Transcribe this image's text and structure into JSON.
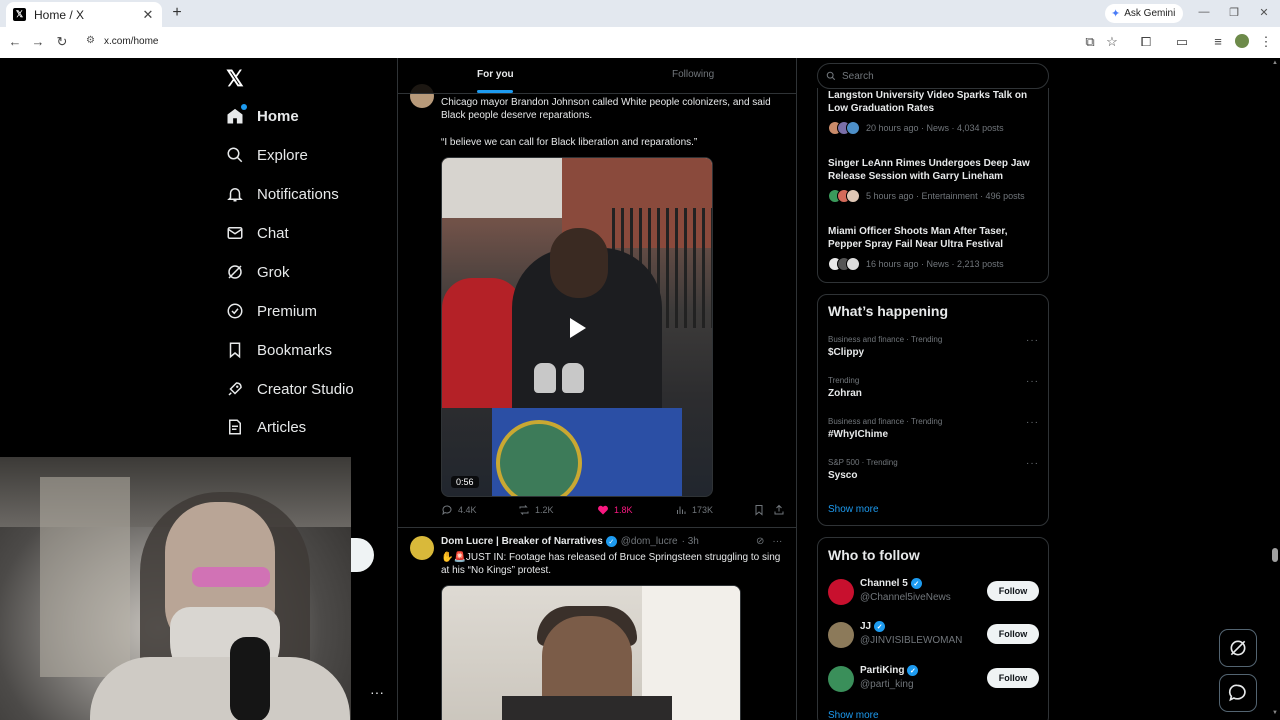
{
  "browser": {
    "tab_title": "Home / X",
    "url": "x.com/home",
    "gemini_label": "Ask Gemini"
  },
  "nav": {
    "items": [
      {
        "label": "Home",
        "icon": "home-icon"
      },
      {
        "label": "Explore",
        "icon": "search-icon"
      },
      {
        "label": "Notifications",
        "icon": "bell-icon"
      },
      {
        "label": "Chat",
        "icon": "mail-icon"
      },
      {
        "label": "Grok",
        "icon": "grok-icon"
      },
      {
        "label": "Premium",
        "icon": "verified-icon"
      },
      {
        "label": "Bookmarks",
        "icon": "bookmark-icon"
      },
      {
        "label": "Creator Studio",
        "icon": "rocket-icon"
      },
      {
        "label": "Articles",
        "icon": "articles-icon"
      }
    ],
    "more_dots": "···"
  },
  "feed": {
    "tabs": [
      {
        "label": "For you",
        "active": true
      },
      {
        "label": "Following",
        "active": false
      }
    ],
    "tweet1": {
      "text1": "Chicago mayor Brandon Johnson called White people colonizers, and said Black people deserve reparations.",
      "text2": "“I believe we can call for Black liberation and reparations.”",
      "duration": "0:56",
      "replies": "4.4K",
      "reposts": "1.2K",
      "likes": "1.8K",
      "views": "173K"
    },
    "tweet2": {
      "name": "Dom Lucre | Breaker of Narratives",
      "handle": "@dom_lucre",
      "time": "· 3h",
      "text": "✋🚨JUST IN: Footage has released of Bruce Springsteen struggling to sing at his “No Kings” protest."
    }
  },
  "right": {
    "search_placeholder": "Search",
    "news": [
      {
        "title": "Langston University Video Sparks Talk on Low Graduation Rates",
        "meta": "20 hours ago · News · 4,034 posts"
      },
      {
        "title": "Singer LeAnn Rimes Undergoes Deep Jaw Release Session with Garry Lineham",
        "meta": "5 hours ago · Entertainment · 496 posts"
      },
      {
        "title": "Miami Officer Shoots Man After Taser, Pepper Spray Fail Near Ultra Festival",
        "meta": "16 hours ago · News · 2,213 posts"
      }
    ],
    "happening": {
      "title": "What’s happening",
      "trends": [
        {
          "category": "Business and finance · Trending",
          "name": "$Clippy"
        },
        {
          "category": "Trending",
          "name": "Zohran"
        },
        {
          "category": "Business and finance · Trending",
          "name": "#WhyIChime"
        },
        {
          "category": "S&P 500 · Trending",
          "name": "Sysco"
        }
      ],
      "show_more": "Show more"
    },
    "who_to_follow": {
      "title": "Who to follow",
      "accounts": [
        {
          "name": "Channel 5",
          "handle": "@Channel5iveNews",
          "button": "Follow",
          "color": "#c8102e"
        },
        {
          "name": "JJ",
          "handle": "@JINVISIBLEWOMAN",
          "button": "Follow",
          "color": "#8c7a5a"
        },
        {
          "name": "PartiKing",
          "handle": "@parti_king",
          "button": "Follow",
          "color": "#3a8f5a"
        }
      ],
      "show_more": "Show more"
    }
  },
  "colors": {
    "accent": "#1d9bf0",
    "like": "#f91880",
    "background": "#000000",
    "border": "#2f3336"
  }
}
